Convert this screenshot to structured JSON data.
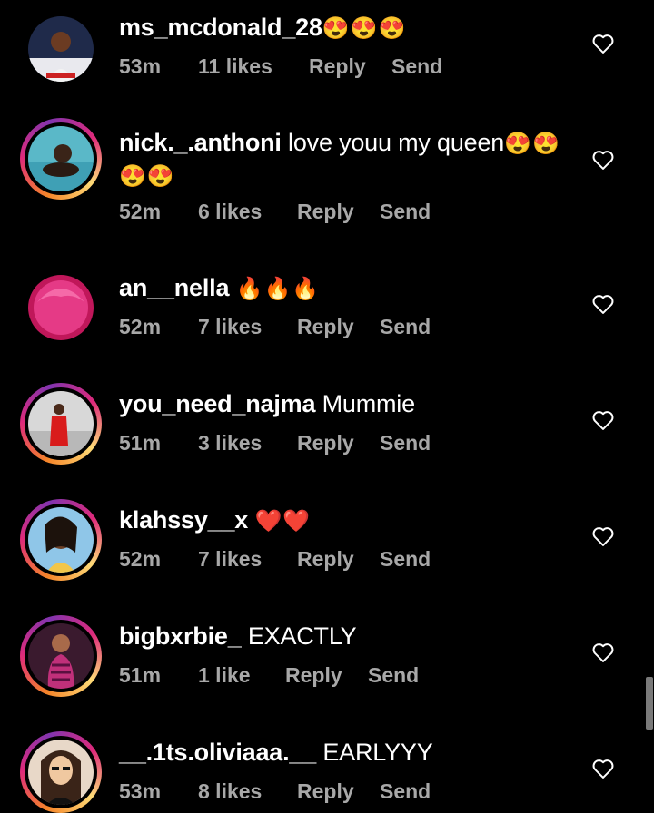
{
  "comments": [
    {
      "username": "ms_mcdonald_28",
      "text": "",
      "emoji": "😍😍😍",
      "time": "53m",
      "likes": "11 likes",
      "reply": "Reply",
      "send": "Send",
      "story_ring": false
    },
    {
      "username": "nick._.anthoni",
      "text": " love youu my queen",
      "emoji": "😍😍",
      "emoji_line2": "😍😍",
      "time": "52m",
      "likes": "6 likes",
      "reply": "Reply",
      "send": "Send",
      "story_ring": true
    },
    {
      "username": "an__nella",
      "text": " ",
      "emoji": "🔥🔥🔥",
      "time": "52m",
      "likes": "7 likes",
      "reply": "Reply",
      "send": "Send",
      "story_ring": false
    },
    {
      "username": "you_need_najma",
      "text": " Mummie",
      "emoji": "",
      "time": "51m",
      "likes": "3 likes",
      "reply": "Reply",
      "send": "Send",
      "story_ring": true
    },
    {
      "username": "klahssy__x",
      "text": " ",
      "emoji": "❤️❤️",
      "time": "52m",
      "likes": "7 likes",
      "reply": "Reply",
      "send": "Send",
      "story_ring": true
    },
    {
      "username": "bigbxrbie_",
      "text": " EXACTLY",
      "emoji": "",
      "time": "51m",
      "likes": "1 like",
      "reply": "Reply",
      "send": "Send",
      "story_ring": true
    },
    {
      "username": "__.1ts.oliviaaa.__",
      "text": " EARLYYY",
      "emoji": "",
      "time": "53m",
      "likes": "8 likes",
      "reply": "Reply",
      "send": "Send",
      "story_ring": true
    }
  ],
  "icons": {
    "like": "heart-outline-icon"
  },
  "colors": {
    "background": "#000000",
    "meta_text": "#a8a8a8",
    "story_ring_start": "#f58529",
    "story_ring_end": "#dd2a7b"
  }
}
